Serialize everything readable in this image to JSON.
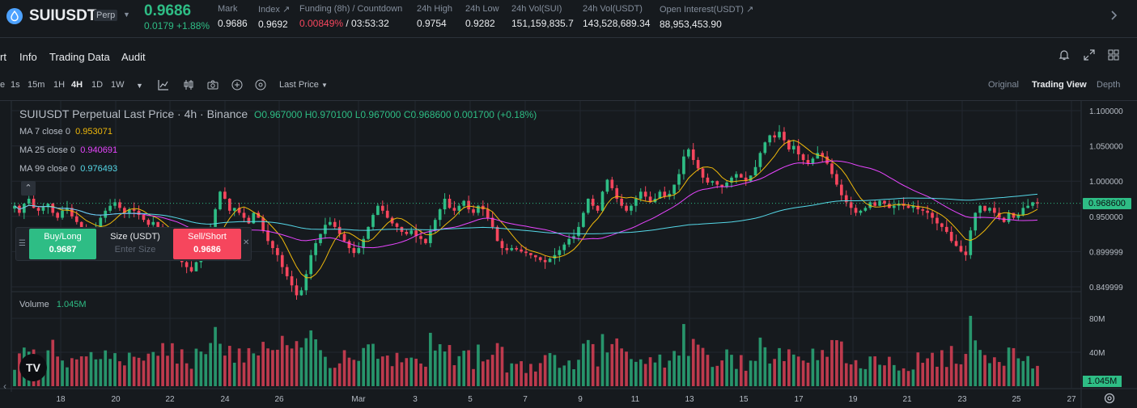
{
  "header": {
    "symbol": "SUIUSDT",
    "badge": "Perp",
    "last_price": "0.9686",
    "change": "0.0179 +1.88%",
    "stats": [
      {
        "label": "Mark",
        "value": "0.9686"
      },
      {
        "label": "Index ↗",
        "value": "0.9692"
      },
      {
        "label": "Funding (8h) / Countdown",
        "value_red": "0.00849%",
        "value": " / 03:53:32"
      },
      {
        "label": "24h High",
        "value": "0.9754"
      },
      {
        "label": "24h Low",
        "value": "0.9282"
      },
      {
        "label": "24h Vol(SUI)",
        "value": "151,159,835.7"
      },
      {
        "label": "24h Vol(USDT)",
        "value": "143,528,689.34"
      },
      {
        "label": "Open Interest(USDT) ↗",
        "value": "88,953,453.90"
      }
    ]
  },
  "tabs": [
    "rt",
    "Info",
    "Trading Data",
    "Audit"
  ],
  "toolbar": {
    "intervals": [
      "1s",
      "15m",
      "1H",
      "4H",
      "1D",
      "1W"
    ],
    "active_interval": "4H",
    "price_type": "Last Price",
    "views": [
      "Original",
      "Trading View",
      "Depth"
    ],
    "active_view": "Trading View"
  },
  "legend": {
    "title": "SUIUSDT Perpetual Last Price · 4h · Binance",
    "ohlc": "O0.967000  H0.970100  L0.967000  C0.968600  0.001700 (+0.18%)",
    "ma7_label": "MA 7 close 0",
    "ma7_value": "0.953071",
    "ma25_label": "MA 25 close 0",
    "ma25_value": "0.940691",
    "ma99_label": "MA 99 close 0",
    "ma99_value": "0.976493",
    "volume_label": "Volume",
    "volume_value": "1.045M"
  },
  "order_panel": {
    "buy_label": "Buy/Long",
    "buy_price": "0.9687",
    "size_label": "Size (USDT)",
    "size_placeholder": "Enter Size",
    "sell_label": "Sell/Short",
    "sell_price": "0.9686"
  },
  "tv_logo": "TV",
  "chart_data": {
    "type": "candlestick",
    "price_axis": [
      "1.100000",
      "1.050000",
      "1.000000",
      "0.950000",
      "0.899999",
      "0.849999"
    ],
    "price_ticks": [
      1.1,
      1.05,
      1.0,
      0.95,
      0.9,
      0.85
    ],
    "volume_axis": [
      "80M",
      "40M"
    ],
    "volume_ticks": [
      80,
      40
    ],
    "current_price_label": "0.968600",
    "current_price": 0.9686,
    "current_volume_label": "1.045M",
    "x_labels": [
      "18",
      "20",
      "22",
      "24",
      "26",
      "Mar",
      "3",
      "5",
      "7",
      "9",
      "11",
      "13",
      "15",
      "17",
      "19",
      "21",
      "23",
      "25",
      "27"
    ],
    "colors": {
      "up": "#2ebd85",
      "down": "#f6465d",
      "ma7": "#f0b90b",
      "ma25": "#e845ff",
      "ma99": "#55d8e8"
    },
    "closes": [
      0.965,
      0.955,
      0.968,
      0.975,
      0.962,
      0.958,
      0.963,
      0.968,
      0.955,
      0.948,
      0.958,
      0.962,
      0.95,
      0.942,
      0.93,
      0.918,
      0.925,
      0.935,
      0.948,
      0.958,
      0.965,
      0.97,
      0.962,
      0.955,
      0.96,
      0.958,
      0.952,
      0.945,
      0.938,
      0.942,
      0.935,
      0.925,
      0.918,
      0.905,
      0.895,
      0.885,
      0.878,
      0.872,
      0.885,
      0.902,
      0.915,
      0.935,
      0.96,
      0.985,
      0.975,
      0.958,
      0.962,
      0.955,
      0.948,
      0.94,
      0.955,
      0.948,
      0.93,
      0.915,
      0.905,
      0.895,
      0.878,
      0.865,
      0.852,
      0.838,
      0.845,
      0.868,
      0.895,
      0.912,
      0.925,
      0.938,
      0.942,
      0.935,
      0.925,
      0.915,
      0.905,
      0.898,
      0.905,
      0.918,
      0.935,
      0.952,
      0.965,
      0.958,
      0.948,
      0.94,
      0.935,
      0.928,
      0.925,
      0.93,
      0.922,
      0.918,
      0.912,
      0.93,
      0.945,
      0.96,
      0.975,
      0.962,
      0.958,
      0.965,
      0.972,
      0.96,
      0.955,
      0.965,
      0.96,
      0.948,
      0.935,
      0.915,
      0.905,
      0.902,
      0.905,
      0.903,
      0.9,
      0.898,
      0.895,
      0.892,
      0.888,
      0.885,
      0.89,
      0.895,
      0.902,
      0.91,
      0.918,
      0.922,
      0.935,
      0.955,
      0.975,
      0.965,
      0.958,
      0.985,
      1.002,
      0.99,
      0.975,
      0.965,
      0.958,
      0.965,
      0.975,
      0.985,
      0.978,
      0.97,
      0.975,
      0.985,
      0.978,
      0.982,
      0.995,
      1.01,
      1.035,
      1.045,
      1.03,
      1.018,
      1.005,
      0.998,
      1.0,
      0.995,
      0.992,
      0.998,
      1.005,
      1.01,
      1.005,
      1.0,
      1.008,
      1.02,
      1.04,
      1.055,
      1.065,
      1.062,
      1.07,
      1.058,
      1.045,
      1.05,
      1.038,
      1.03,
      1.025,
      1.032,
      1.04,
      1.035,
      1.025,
      1.01,
      0.995,
      0.98,
      0.97,
      0.962,
      0.955,
      0.958,
      0.962,
      0.97,
      0.965,
      0.972,
      0.968,
      0.962,
      0.965,
      0.968,
      0.965,
      0.962,
      0.965,
      0.96,
      0.958,
      0.955,
      0.948,
      0.94,
      0.935,
      0.928,
      0.915,
      0.908,
      0.9,
      0.895,
      0.93,
      0.955,
      0.965,
      0.958,
      0.962,
      0.955,
      0.948,
      0.942,
      0.955,
      0.948,
      0.952,
      0.962,
      0.965,
      0.97,
      0.968
    ],
    "opens_note": "open equals previous close"
  }
}
